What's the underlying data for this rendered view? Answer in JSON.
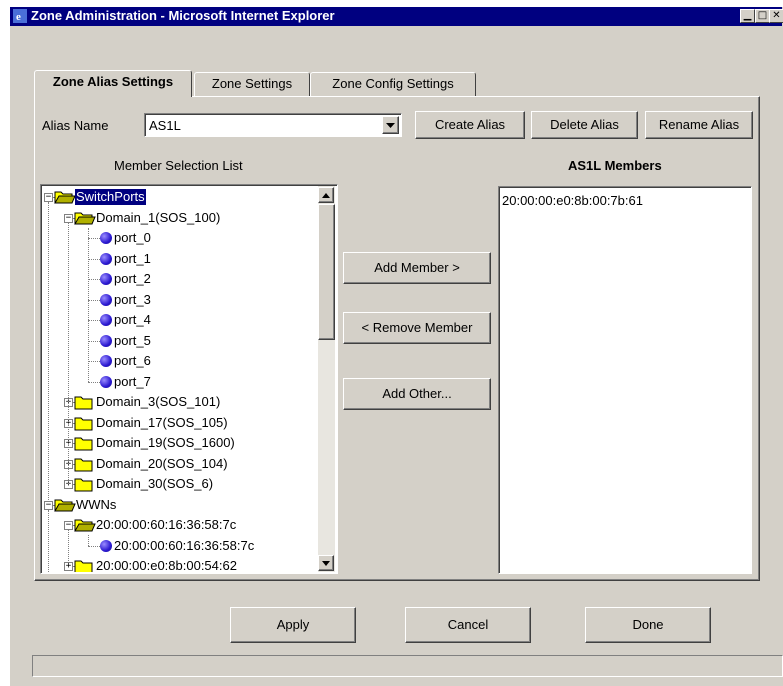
{
  "window": {
    "title": "Zone Administration - Microsoft Internet Explorer"
  },
  "tabs": [
    {
      "label": "Zone Alias Settings",
      "active": true
    },
    {
      "label": "Zone Settings",
      "active": false
    },
    {
      "label": "Zone Config Settings",
      "active": false
    }
  ],
  "alias": {
    "label": "Alias Name",
    "value": "AS1L",
    "create_label": "Create Alias",
    "delete_label": "Delete Alias",
    "rename_label": "Rename Alias"
  },
  "member_list": {
    "heading": "Member Selection List",
    "tree": [
      {
        "label": "SwitchPorts",
        "level": 0,
        "kind": "folder-open",
        "expander": "minus",
        "selected": true
      },
      {
        "label": "Domain_1(SOS_100)",
        "level": 1,
        "kind": "folder-open",
        "expander": "minus"
      },
      {
        "label": "port_0",
        "level": 2,
        "kind": "port"
      },
      {
        "label": "port_1",
        "level": 2,
        "kind": "port"
      },
      {
        "label": "port_2",
        "level": 2,
        "kind": "port"
      },
      {
        "label": "port_3",
        "level": 2,
        "kind": "port"
      },
      {
        "label": "port_4",
        "level": 2,
        "kind": "port"
      },
      {
        "label": "port_5",
        "level": 2,
        "kind": "port"
      },
      {
        "label": "port_6",
        "level": 2,
        "kind": "port"
      },
      {
        "label": "port_7",
        "level": 2,
        "kind": "port"
      },
      {
        "label": "Domain_3(SOS_101)",
        "level": 1,
        "kind": "folder",
        "expander": "plus"
      },
      {
        "label": "Domain_17(SOS_105)",
        "level": 1,
        "kind": "folder",
        "expander": "plus"
      },
      {
        "label": "Domain_19(SOS_1600)",
        "level": 1,
        "kind": "folder",
        "expander": "plus"
      },
      {
        "label": "Domain_20(SOS_104)",
        "level": 1,
        "kind": "folder",
        "expander": "plus"
      },
      {
        "label": "Domain_30(SOS_6)",
        "level": 1,
        "kind": "folder",
        "expander": "plus"
      },
      {
        "label": "WWNs",
        "level": 0,
        "kind": "folder-open",
        "expander": "minus"
      },
      {
        "label": "20:00:00:60:16:36:58:7c",
        "level": 1,
        "kind": "folder-open",
        "expander": "minus"
      },
      {
        "label": "20:00:00:60:16:36:58:7c",
        "level": 2,
        "kind": "port"
      },
      {
        "label": "20:00:00:e0:8b:00:54:62",
        "level": 1,
        "kind": "folder",
        "expander": "plus"
      }
    ]
  },
  "actions": {
    "add_member": "Add Member >",
    "remove_member": "< Remove Member",
    "add_other": "Add Other..."
  },
  "members": {
    "heading": "AS1L Members",
    "items": [
      "20:00:00:e0:8b:00:7b:61"
    ]
  },
  "footer": {
    "apply": "Apply",
    "cancel": "Cancel",
    "done": "Done"
  },
  "colors": {
    "titlebar": "#000080",
    "face": "#d4d0c8",
    "folder": "#ffff00",
    "port": "#2a18d0"
  }
}
